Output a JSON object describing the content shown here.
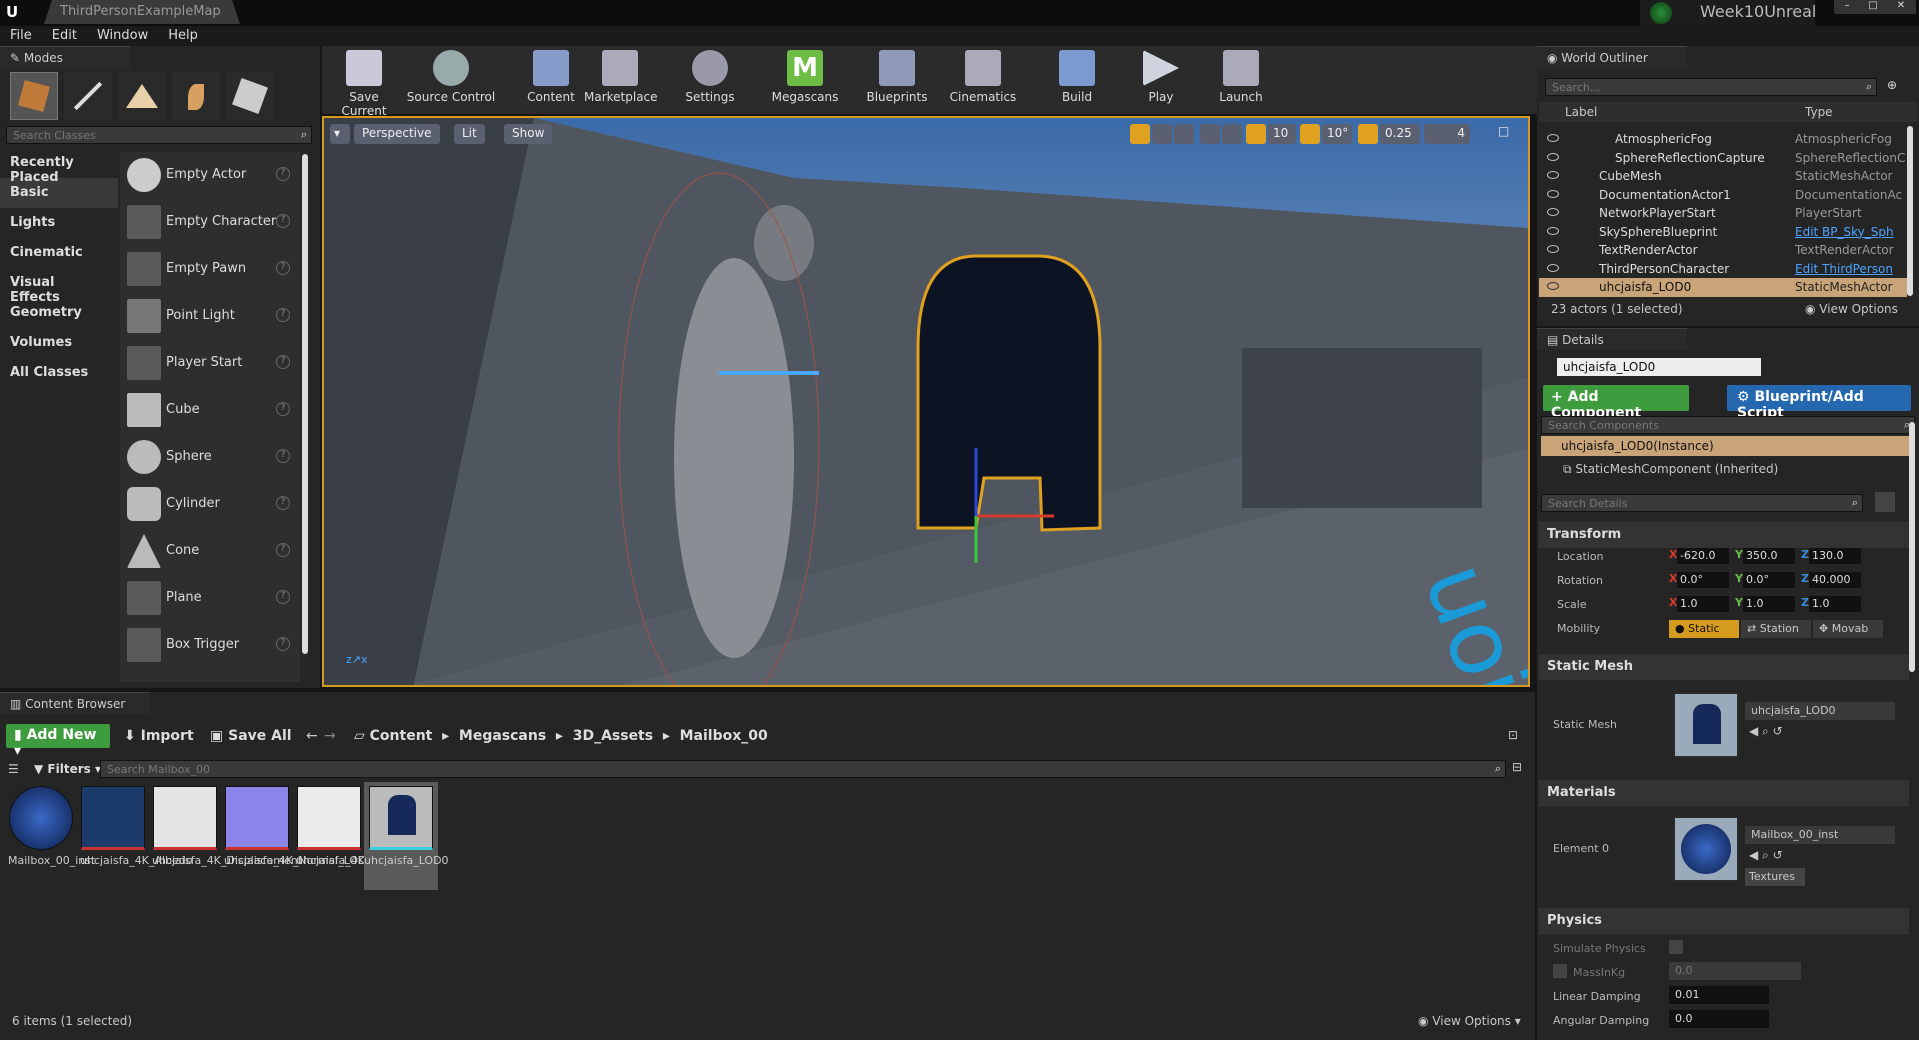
{
  "window": {
    "tab": "ThirdPersonExampleMap",
    "project": "Week10Unreal"
  },
  "menu": [
    "File",
    "Edit",
    "Window",
    "Help"
  ],
  "modes": {
    "title": "Modes",
    "search_placeholder": "Search Classes",
    "categories": [
      "Recently Placed",
      "Basic",
      "Lights",
      "Cinematic",
      "Visual Effects",
      "Geometry",
      "Volumes",
      "All Classes"
    ],
    "items": [
      "Empty Actor",
      "Empty Character",
      "Empty Pawn",
      "Point Light",
      "Player Start",
      "Cube",
      "Sphere",
      "Cylinder",
      "Cone",
      "Plane",
      "Box Trigger"
    ]
  },
  "toolbar": {
    "buttons": [
      "Save Current",
      "Source Control",
      "Content",
      "Marketplace",
      "Settings",
      "Megascans",
      "Blueprints",
      "Cinematics",
      "Build",
      "Play",
      "Launch"
    ]
  },
  "viewport": {
    "perspective": "Perspective",
    "lit": "Lit",
    "show": "Show",
    "grid": "10",
    "rot": "10°",
    "scale": "0.25",
    "cam": "4"
  },
  "outliner": {
    "title": "World Outliner",
    "search_placeholder": "Search...",
    "col_label": "Label",
    "col_type": "Type",
    "rows": [
      {
        "name": "AtmosphericFog",
        "type": "AtmosphericFog",
        "link": false
      },
      {
        "name": "SphereReflectionCapture",
        "type": "SphereReflectionC",
        "link": false
      },
      {
        "name": "CubeMesh",
        "type": "StaticMeshActor",
        "link": false
      },
      {
        "name": "DocumentationActor1",
        "type": "DocumentationAc",
        "link": false
      },
      {
        "name": "NetworkPlayerStart",
        "type": "PlayerStart",
        "link": false
      },
      {
        "name": "SkySphereBlueprint",
        "type": "Edit BP_Sky_Sph",
        "link": true
      },
      {
        "name": "TextRenderActor",
        "type": "TextRenderActor",
        "link": false
      },
      {
        "name": "ThirdPersonCharacter",
        "type": "Edit ThirdPerson",
        "link": true
      },
      {
        "name": "uhcjaisfa_LOD0",
        "type": "StaticMeshActor",
        "link": false
      }
    ],
    "status": "23 actors (1 selected)",
    "view_options": "View Options"
  },
  "details": {
    "title": "Details",
    "name": "uhcjaisfa_LOD0",
    "add_component": "+ Add Component",
    "blueprint": "Blueprint/Add Script",
    "search_components": "Search Components",
    "instance": "uhcjaisfa_LOD0(Instance)",
    "component": "StaticMeshComponent (Inherited)",
    "search_details": "Search Details",
    "transform": "Transform",
    "location_label": "Location",
    "rotation_label": "Rotation",
    "scale_label": "Scale",
    "mobility_label": "Mobility",
    "location": [
      "-620.0",
      "350.0",
      "130.0"
    ],
    "rotation": [
      "0.0°",
      "0.0°",
      "40.000"
    ],
    "scale": [
      "1.0",
      "1.0",
      "1.0"
    ],
    "mobility": [
      "Static",
      "Station",
      "Movab"
    ],
    "static_mesh_section": "Static Mesh",
    "static_mesh_label": "Static Mesh",
    "static_mesh_value": "uhcjaisfa_LOD0",
    "materials_section": "Materials",
    "element0": "Element 0",
    "material_value": "Mailbox_00_inst",
    "textures": "Textures",
    "physics_section": "Physics",
    "simulate": "Simulate Physics",
    "mass": "MassInKg",
    "mass_value": "0.0",
    "linear": "Linear Damping",
    "linear_value": "0.01",
    "angular": "Angular Damping",
    "angular_value": "0.0"
  },
  "content": {
    "title": "Content Browser",
    "add_new": "Add New",
    "import": "Import",
    "save_all": "Save All",
    "path": [
      "Content",
      "Megascans",
      "3D_Assets",
      "Mailbox_00"
    ],
    "filters": "Filters",
    "search_placeholder": "Search Mailbox_00",
    "assets": [
      "Mailbox_00_inst",
      "uhcjaisfa_4K_Albedo",
      "uhcjaisfa_4K_Displacement",
      "uhcjaisfa_4K_Normal_LOD0",
      "uhcjaisfa_4K_Roughness",
      "uhcjaisfa_LOD0"
    ],
    "status": "6 items (1 selected)",
    "view_options": "View Options"
  },
  "colors": {
    "accent": "#d59b1f",
    "selected": "#c8a478",
    "green": "#3e9b3e",
    "blue": "#2568b0"
  }
}
